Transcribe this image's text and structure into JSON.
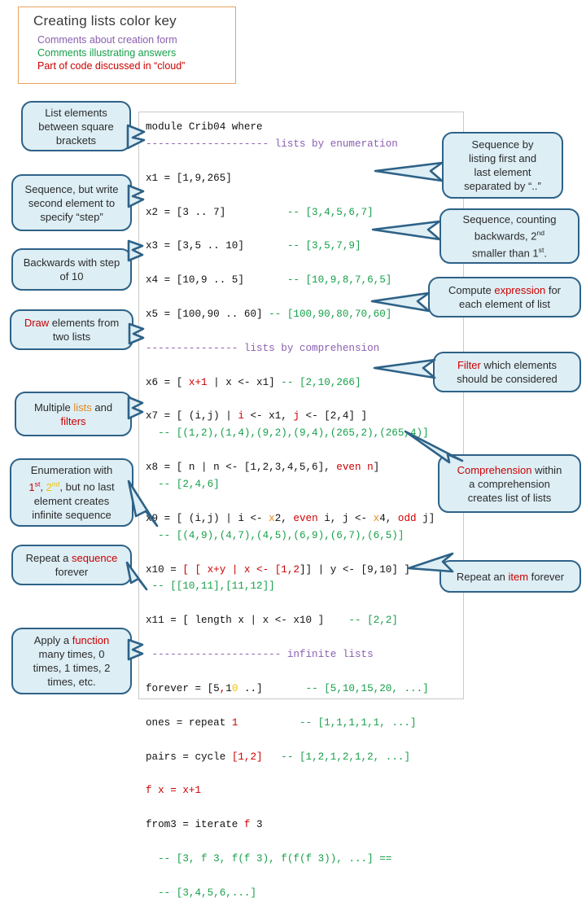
{
  "color_key": {
    "title": "Creating lists color key",
    "lines": [
      {
        "text": "Comments about creation form",
        "color": "#8a5fb0",
        "name": "key-line-purple"
      },
      {
        "text": "Comments illustrating answers",
        "color": "#17a04a",
        "name": "key-line-green"
      },
      {
        "text": "Part of code discussed in “cloud”",
        "color": "#cc0000",
        "name": "key-line-red"
      }
    ],
    "border_color": "#e8a35c"
  },
  "code": {
    "language": "haskell",
    "module_header": "module Crib04 where",
    "section_enumeration": "-------------------- lists by enumeration",
    "section_comprehension": "--------------- lists by comprehension",
    "section_infinite": "--------------------- infinite lists",
    "lines": [
      "module Crib04 where",
      "-------------------- lists by enumeration",
      "x1 = [1,9,265]",
      "x2 = [3 .. 7]          -- [3,4,5,6,7]",
      "x3 = [3,5 .. 10]       -- [3,5,7,9]",
      "x4 = [10,9 .. 5]       -- [10,9,8,7,6,5]",
      "x5 = [100,90 .. 60] -- [100,90,80,70,60]",
      "--------------- lists by comprehension",
      "x6 = [ x+1 | x <- x1] -- [2,10,266]",
      "x7 = [ (i,j) | i <- x1, j <- [2,4] ]",
      "  -- [(1,2),(1,4),(9,2),(9,4),(265,2),(265,4)]",
      "x8 = [ n | n <- [1,2,3,4,5,6], even n]",
      "  -- [2,4,6]",
      "x9 = [ (i,j) | i <- x2, even i, j <- x4, odd j]",
      "  -- [(4,9),(4,7),(4,5),(6,9),(6,7),(6,5)]",
      "x10 = [ [ x+y | x <- [1,2]] | y <- [9,10] ]",
      " -- [[10,11],[11,12]]",
      "x11 = [ length x | x <- x10 ]    -- [2,2]",
      " --------------------- infinite lists",
      "forever = [5,10 ..]       -- [5,10,15,20, ...]",
      "ones = repeat 1          -- [1,1,1,1,1, ...]",
      "pairs = cycle [1,2]   -- [1,2,1,2,1,2, ...]",
      "f x = x+1",
      "from3 = iterate f 3",
      "  -- [3, f 3, f(f 3), f(f(f 3)), ...] ==",
      "  -- [3,4,5,6,...]"
    ]
  },
  "callouts_left": [
    {
      "name": "callout-list-elements",
      "html": "List elements<br>between square<br>brackets"
    },
    {
      "name": "callout-second-element-step",
      "html": "Sequence, but write<br>second element to<br>specify “step”"
    },
    {
      "name": "callout-backwards-step-10",
      "html": "Backwards with step<br>of 10"
    },
    {
      "name": "callout-draw-two-lists",
      "html": "<span class=\"c-red\">Draw</span> elements from<br>two lists"
    },
    {
      "name": "callout-multiple-lists-filters",
      "html": "Multiple <span class=\"c-orange\">lists</span> and<br><span class=\"c-red\">filters</span>"
    },
    {
      "name": "callout-enumeration-infinite",
      "html": "Enumeration with<br><span class=\"c-red\">1<sup>st</sup></span>, <span class=\"c-gold\">2<sup>nd</sup></span>, but no last<br>element creates<br>infinite sequence"
    },
    {
      "name": "callout-repeat-sequence",
      "html": "Repeat a <span class=\"c-red\">sequence</span><br>forever"
    },
    {
      "name": "callout-apply-function",
      "html": "Apply a <span class=\"c-red\">function</span><br>many times, 0<br>times, 1 times, 2<br>times, etc."
    }
  ],
  "callouts_right": [
    {
      "name": "callout-sequence-first-last",
      "html": "Sequence by<br>listing first and<br>last element<br>separated by “..”"
    },
    {
      "name": "callout-counting-backwards",
      "html": "Sequence, counting<br>backwards, 2<sup>nd</sup><br>smaller than 1<sup>st</sup>."
    },
    {
      "name": "callout-compute-expression",
      "html": "Compute <span class=\"c-red\">expression</span> for<br>each element of list"
    },
    {
      "name": "callout-filter-elements",
      "html": "<span class=\"c-red\">Filter</span> which elements<br>should be considered"
    },
    {
      "name": "callout-nested-comprehension",
      "html": "<span class=\"c-red\">Comprehension</span> within<br>a comprehension<br>creates list of lists"
    },
    {
      "name": "callout-repeat-item",
      "html": "Repeat an <span class=\"c-red\">item</span> forever"
    }
  ],
  "colors": {
    "callout_fill": "#ddeef5",
    "callout_border": "#2e6287",
    "comment_purple": "#8a5fb0",
    "answer_green": "#17a04a",
    "highlight_red": "#cc0000",
    "highlight_orange": "#e8871a",
    "highlight_gold": "#f2c200"
  }
}
